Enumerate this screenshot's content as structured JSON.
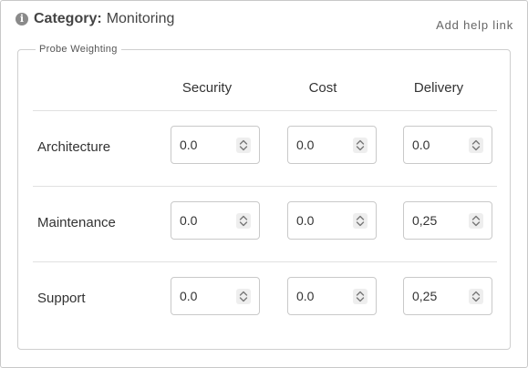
{
  "header": {
    "category_label": "Category:",
    "category_value": "Monitoring",
    "help_link": "Add help link"
  },
  "group": {
    "legend": "Probe Weighting",
    "columns": [
      "Security",
      "Cost",
      "Delivery"
    ],
    "rows": [
      {
        "label": "Architecture",
        "values": [
          "0.0",
          "0.0",
          "0.0"
        ]
      },
      {
        "label": "Maintenance",
        "values": [
          "0.0",
          "0.0",
          "0,25"
        ]
      },
      {
        "label": "Support",
        "values": [
          "0.0",
          "0.0",
          "0,25"
        ]
      }
    ]
  },
  "icons": {
    "info": "info-icon",
    "spinner": "up-down-chevron-icon"
  }
}
